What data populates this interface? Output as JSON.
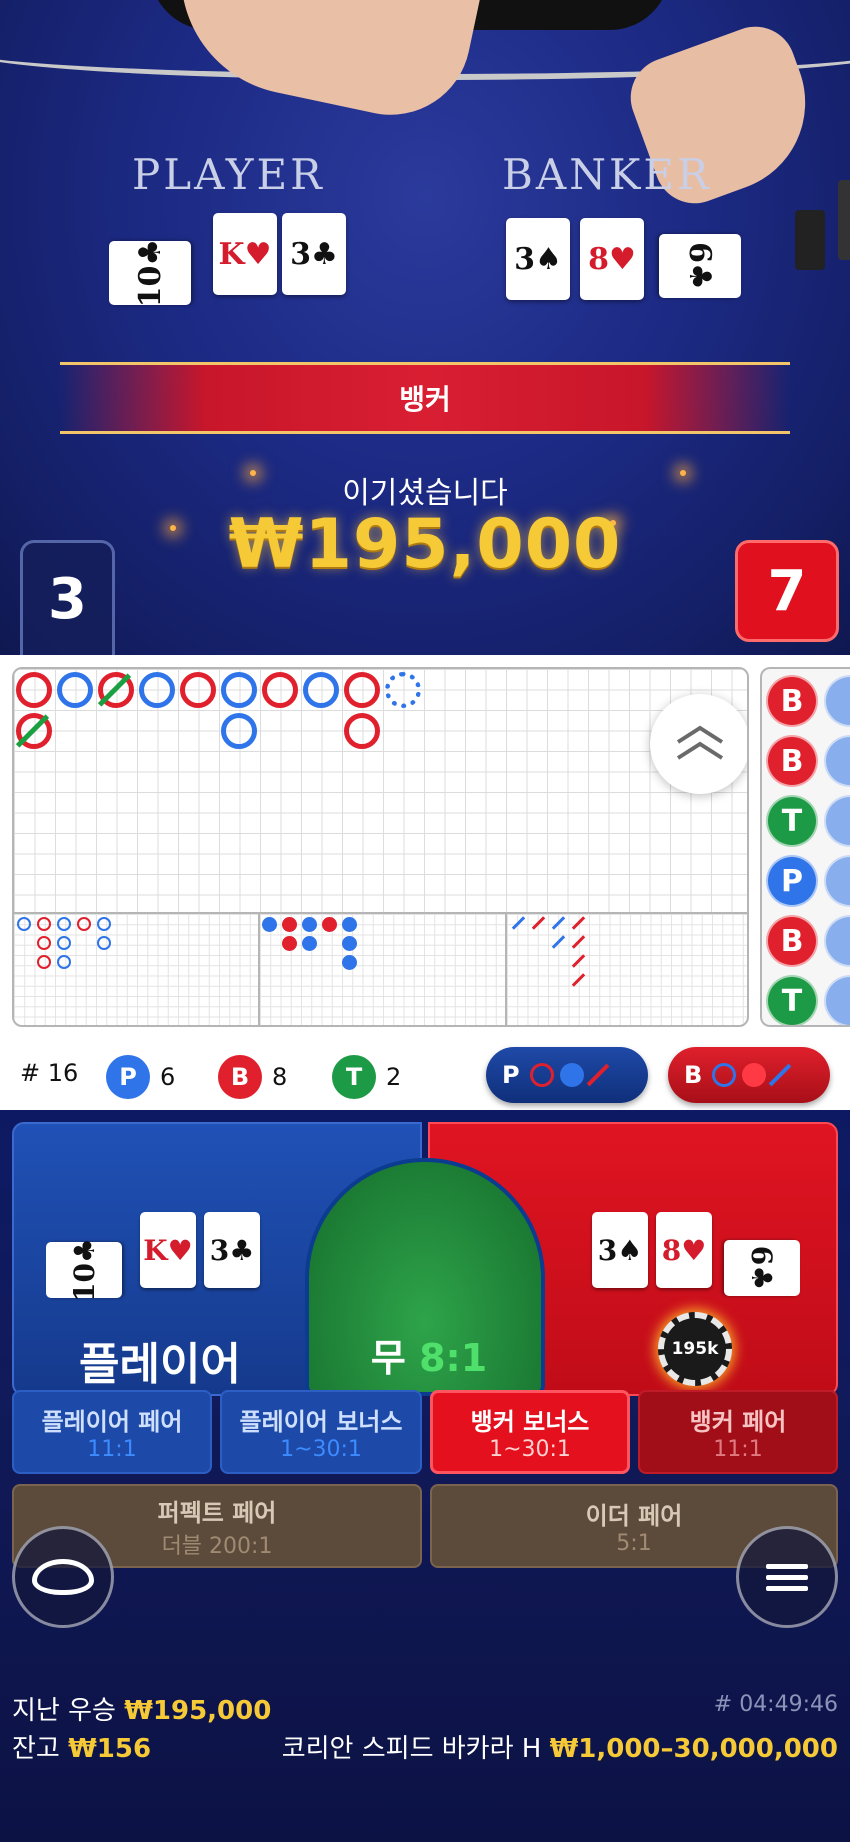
{
  "table": {
    "player_word": "PLAYER",
    "banker_word": "BANKER",
    "player_cards": [
      {
        "rank": "10",
        "suit": "♣",
        "color": "black"
      },
      {
        "rank": "K",
        "suit": "♥",
        "color": "red"
      },
      {
        "rank": "3",
        "suit": "♣",
        "color": "black"
      }
    ],
    "banker_cards": [
      {
        "rank": "3",
        "suit": "♠",
        "color": "black"
      },
      {
        "rank": "8",
        "suit": "♥",
        "color": "red"
      },
      {
        "rank": "6",
        "suit": "♣",
        "color": "black"
      }
    ]
  },
  "result": {
    "banner": "뱅커",
    "win_message": "이기셨습니다",
    "win_amount": "₩195,000",
    "player_score": "3",
    "banker_score": "7"
  },
  "roadmap": {
    "bead_plate": [
      "B",
      "B",
      "T",
      "P",
      "B",
      "T"
    ],
    "stats": {
      "count_label": "# 16",
      "player_letter": "P",
      "player_count": "6",
      "banker_letter": "B",
      "banker_count": "8",
      "tie_letter": "T",
      "tie_count": "2"
    },
    "predict_player": "P",
    "predict_banker": "B",
    "colors": {
      "banker": "#e0202c",
      "player": "#2f74e8",
      "tie": "#1d9a45"
    }
  },
  "betting": {
    "player_label": "플레이어",
    "tie_label": "무",
    "tie_odds": "8:1",
    "chip_value": "195k",
    "side_bets": [
      {
        "title": "플레이어 페어",
        "odds": "11:1"
      },
      {
        "title": "플레이어 보너스",
        "odds": "1~30:1"
      },
      {
        "title": "뱅커 보너스",
        "odds": "1~30:1"
      },
      {
        "title": "뱅커 페어",
        "odds": "11:1"
      },
      {
        "title": "퍼펙트 페어",
        "odds": "더블 200:1"
      },
      {
        "title": "이더 페어",
        "odds": "5:1"
      }
    ]
  },
  "footer": {
    "last_win_label": "지난 우승",
    "last_win_amount": "₩195,000",
    "round_id": "# 04:49:46",
    "balance_label": "잔고",
    "balance_amount": "₩156",
    "table_name": "코리안 스피드 바카라 H",
    "bet_limits": "₩1,000–30,000,000"
  }
}
